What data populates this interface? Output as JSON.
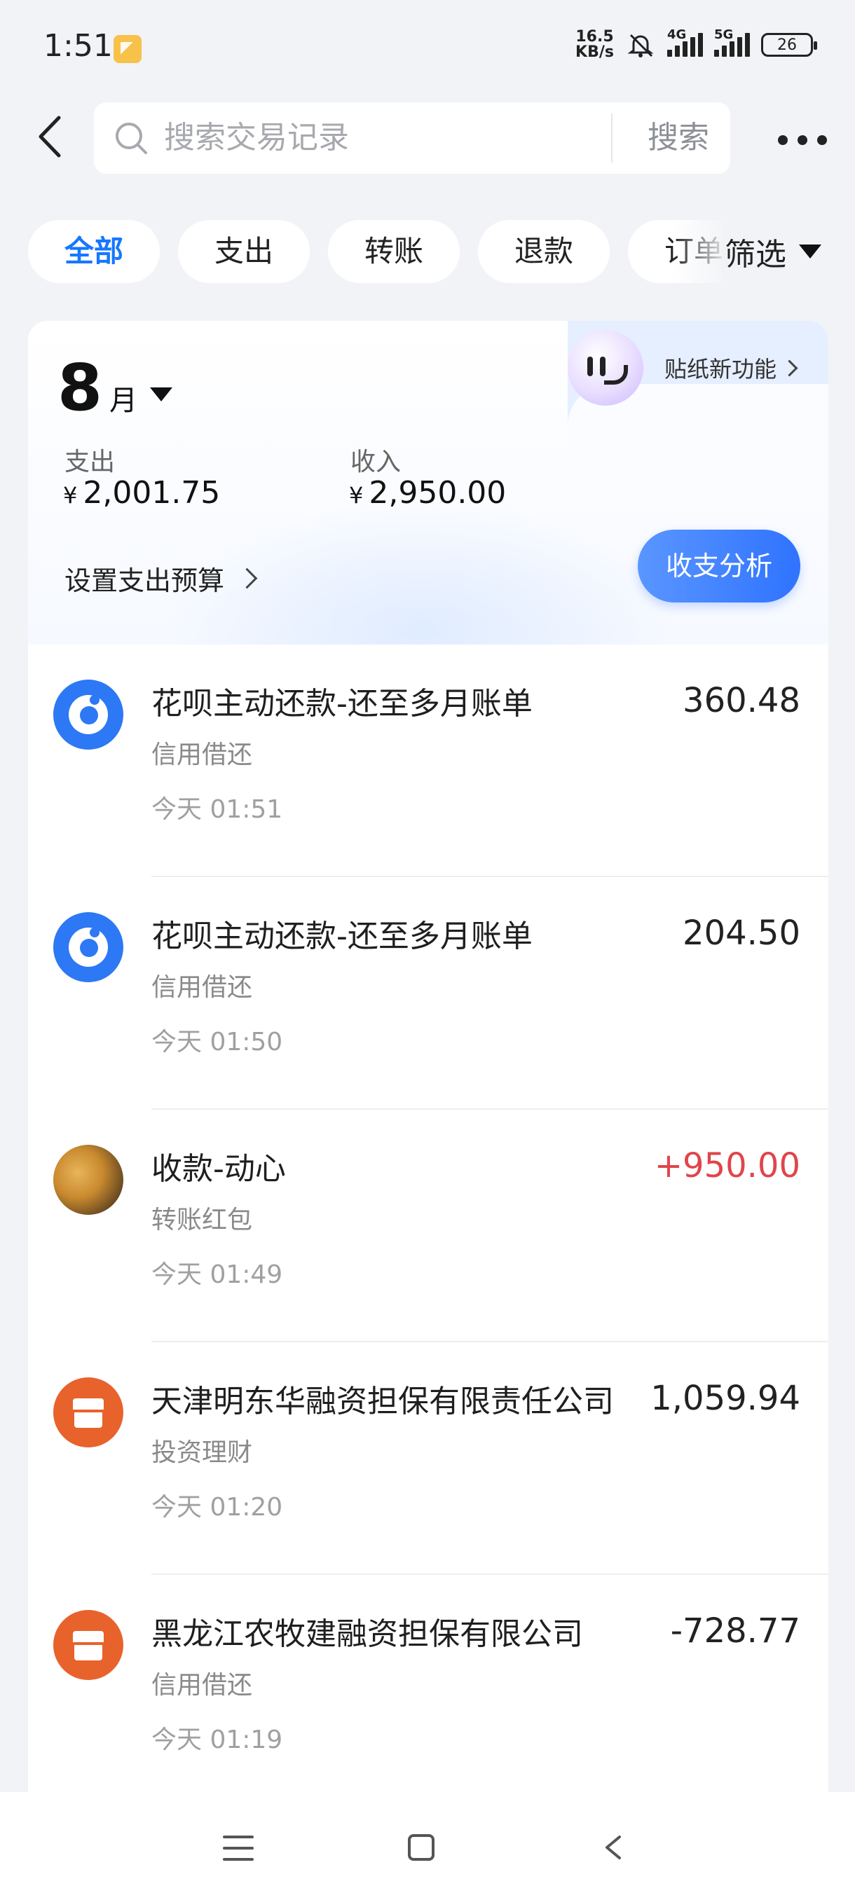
{
  "status_bar": {
    "time": "1:51",
    "net_speed_value": "16.5",
    "net_speed_unit": "KB/s",
    "signal_1": "4G",
    "signal_2": "5G",
    "battery": "26"
  },
  "header": {
    "search_placeholder": "搜索交易记录",
    "search_button": "搜索"
  },
  "filters": {
    "chips": [
      "全部",
      "支出",
      "转账",
      "退款",
      "订单"
    ],
    "active": "全部",
    "filter_label": "筛选"
  },
  "summary": {
    "sticker_label": "贴纸新功能",
    "month": "8",
    "month_unit": "月",
    "expense_label": "支出",
    "expense_currency": "¥",
    "expense_value": "2,001.75",
    "income_label": "收入",
    "income_currency": "¥",
    "income_value": "2,950.00",
    "budget_label": "设置支出预算",
    "analysis_label": "收支分析"
  },
  "transactions": [
    {
      "title": "花呗主动还款-还至多月账单",
      "category": "信用借还",
      "time": "今天 01:51",
      "amount": "360.48",
      "icon": "huabei-icon"
    },
    {
      "title": "花呗主动还款-还至多月账单",
      "category": "信用借还",
      "time": "今天 01:50",
      "amount": "204.50",
      "icon": "huabei-icon"
    },
    {
      "title": "收款-动心",
      "category": "转账红包",
      "time": "今天 01:49",
      "amount": "+950.00",
      "icon": "contact-avatar"
    },
    {
      "title": "天津明东华融资担保有限责任公司",
      "category": "投资理财",
      "time": "今天 01:20",
      "amount": "1,059.94",
      "icon": "shop-icon"
    },
    {
      "title": "黑龙江农牧建融资担保有限公司",
      "category": "信用借还",
      "time": "今天 01:19",
      "amount": "-728.77",
      "icon": "shop-icon"
    }
  ],
  "colors": {
    "accent": "#1677ff",
    "income_amount": "#e0454a",
    "button_gradient_start": "#5a96ff",
    "button_gradient_end": "#2f73ff"
  }
}
